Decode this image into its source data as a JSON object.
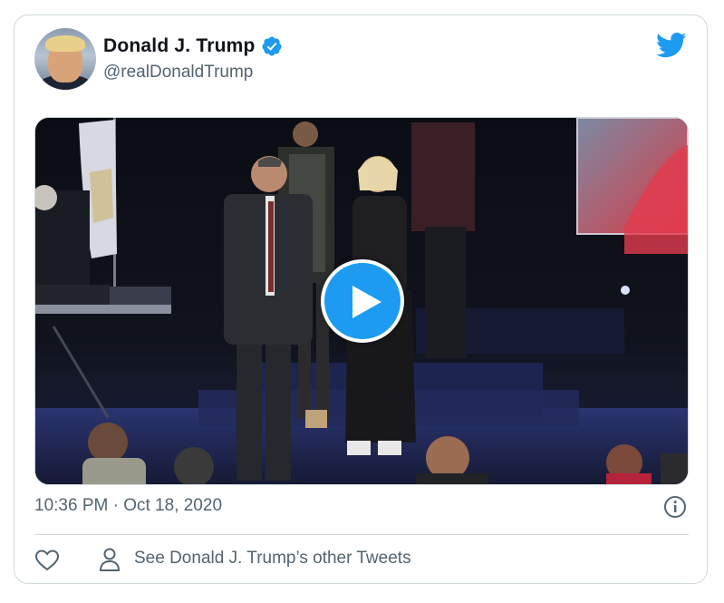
{
  "tweet": {
    "author_name": "Donald J. Trump",
    "author_handle": "@realDonaldTrump",
    "verified": true,
    "timestamp": "10:36 PM · Oct 18, 2020",
    "other_tweets_label": "See Donald J. Trump’s other Tweets"
  },
  "icons": {
    "brand": "twitter-bird-icon",
    "verified": "verified-badge-icon",
    "play": "play-icon",
    "info": "info-icon",
    "like": "heart-icon",
    "profile": "person-icon"
  },
  "colors": {
    "brand_blue": "#1d9bf0",
    "text_primary": "#0f1419",
    "text_secondary": "#536471",
    "border": "#cfd9de"
  }
}
